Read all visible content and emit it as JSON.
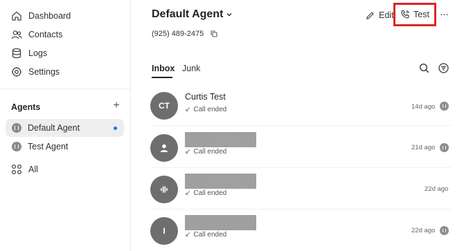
{
  "sidebar": {
    "nav": [
      {
        "label": "Dashboard",
        "icon": "home-icon"
      },
      {
        "label": "Contacts",
        "icon": "contacts-icon"
      },
      {
        "label": "Logs",
        "icon": "database-icon"
      },
      {
        "label": "Settings",
        "icon": "gear-icon"
      }
    ],
    "agents_title": "Agents",
    "agents_add": "+",
    "agents": [
      {
        "label": "Default Agent",
        "active": true,
        "unread": true
      },
      {
        "label": "Test Agent",
        "active": false,
        "unread": false
      }
    ],
    "all_label": "All"
  },
  "header": {
    "agent_name": "Default Agent",
    "phone": "(925) 489-2475",
    "edit_label": "Edit",
    "test_label": "Test",
    "more_label": "···"
  },
  "tabs": [
    {
      "label": "Inbox",
      "active": true
    },
    {
      "label": "Junk",
      "active": false
    }
  ],
  "conversations": [
    {
      "initials": "CT",
      "name": "Curtis Test",
      "status": "Call ended",
      "time": "14d ago",
      "redacted": false
    },
    {
      "initials": "",
      "name": "",
      "status": "Call ended",
      "time": "21d ago",
      "redacted": true,
      "avatar_icon": "person-icon"
    },
    {
      "initials": "",
      "name": "",
      "status": "Call ended",
      "time": "22d ago",
      "redacted": true,
      "avatar_icon": "voice-wave-icon"
    },
    {
      "initials": "I",
      "name": "",
      "status": "Call ended",
      "time": "22d ago",
      "redacted": true
    }
  ],
  "colors": {
    "highlight_border": "#e02424",
    "unread_dot": "#1a73e8",
    "avatar_bg": "#6e6e6e"
  }
}
